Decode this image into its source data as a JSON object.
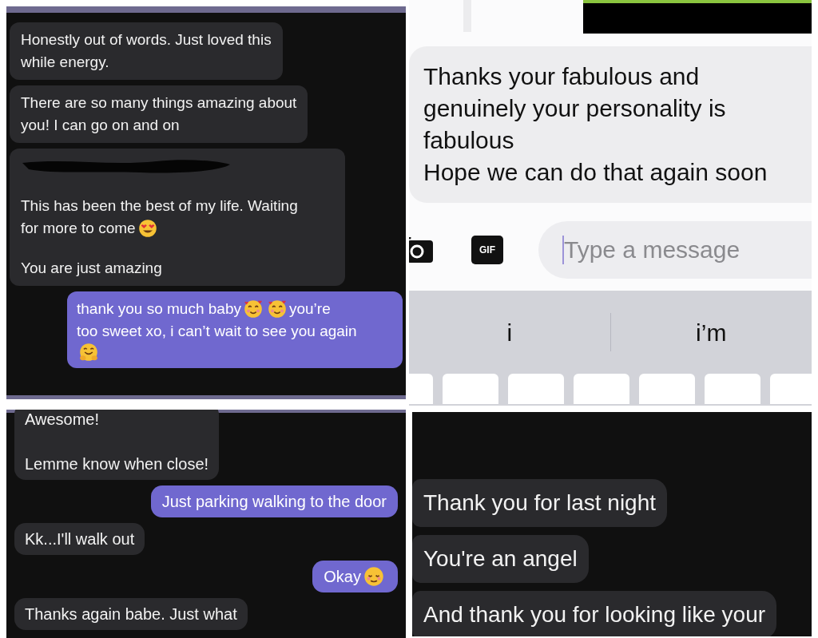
{
  "panels": [
    {
      "kind": "dark_chat",
      "messages": [
        {
          "kind": "received",
          "parts": [
            {
              "kind": "text",
              "text": "Honestly out of words. Just loved this\nwhile energy."
            }
          ]
        },
        {
          "kind": "received",
          "parts": [
            {
              "kind": "text",
              "text": "There are so many things amazing about\nyou! I can go on and on"
            }
          ]
        },
        {
          "kind": "received",
          "parts": [
            {
              "kind": "redacted"
            },
            {
              "kind": "text",
              "text": "This has been the best of my life. Waiting"
            },
            {
              "kind": "line_break"
            },
            {
              "kind": "text",
              "text": "for more to come"
            },
            {
              "kind": "heart_eyes"
            },
            {
              "kind": "line_break"
            },
            {
              "kind": "gap"
            },
            {
              "kind": "text",
              "text": "You are just amazing"
            }
          ]
        },
        {
          "kind": "sent",
          "parts": [
            {
              "kind": "text",
              "text": "thank you so much baby"
            },
            {
              "kind": "hearts"
            },
            {
              "kind": "hearts"
            },
            {
              "kind": "text",
              "text": "you’re"
            },
            {
              "kind": "line_break"
            },
            {
              "kind": "text",
              "text": "too sweet xo, i can’t wait to see you again"
            },
            {
              "kind": "line_break"
            },
            {
              "kind": "hugging"
            }
          ]
        }
      ]
    },
    {
      "kind": "light_chat",
      "messages": [
        {
          "kind": "received",
          "parts": [
            {
              "kind": "text",
              "text": "Thanks your fabulous and\ngenuinely your personality is\nfabulous\nHope we can do that again soon"
            }
          ]
        }
      ],
      "composer": {
        "gif_label": "GIF",
        "placeholder": "Type a message"
      },
      "suggestions": [
        "i",
        "i’m"
      ]
    },
    {
      "kind": "dark_chat",
      "messages": [
        {
          "kind": "received",
          "parts": [
            {
              "kind": "text",
              "text": "Awesome!\n\nLemme know when close!"
            }
          ]
        },
        {
          "kind": "sent",
          "parts": [
            {
              "kind": "text",
              "text": "Just parking walking to the door"
            }
          ]
        },
        {
          "kind": "received",
          "parts": [
            {
              "kind": "text",
              "text": "Kk...I'll walk out"
            }
          ]
        },
        {
          "kind": "sent",
          "parts": [
            {
              "kind": "text",
              "text": "Okay"
            },
            {
              "kind": "blush"
            }
          ]
        },
        {
          "kind": "received",
          "parts": [
            {
              "kind": "text",
              "text": "Thanks again babe. Just what"
            }
          ]
        }
      ]
    },
    {
      "kind": "dark_chat",
      "messages": [
        {
          "kind": "received",
          "parts": [
            {
              "kind": "text",
              "text": "Thank you for last night"
            }
          ]
        },
        {
          "kind": "received",
          "parts": [
            {
              "kind": "text",
              "text": "You're an angel"
            }
          ]
        },
        {
          "kind": "received",
          "parts": [
            {
              "kind": "text",
              "text": "And thank you for looking like your"
            }
          ]
        }
      ]
    }
  ]
}
